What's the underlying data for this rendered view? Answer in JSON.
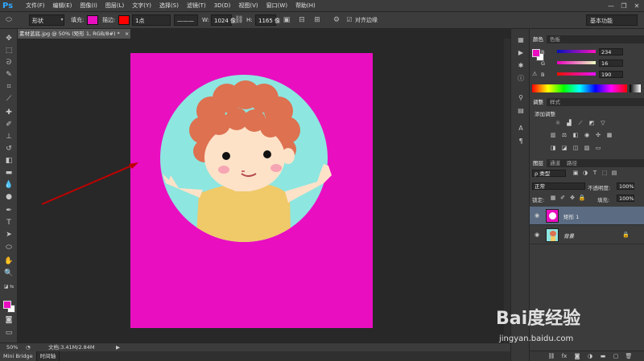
{
  "app": {
    "logo": "Ps"
  },
  "menu": [
    "文件(F)",
    "编辑(E)",
    "图像(I)",
    "图层(L)",
    "文字(Y)",
    "选择(S)",
    "滤镜(T)",
    "3D(D)",
    "视图(V)",
    "窗口(W)",
    "帮助(H)"
  ],
  "window_controls": {
    "minimize": "—",
    "restore": "❐",
    "close": "✕"
  },
  "options": {
    "shape_mode": "形状",
    "fill_label": "填充:",
    "fill_color": "#ea0ec1",
    "stroke_label": "描边:",
    "stroke_color": "#ff0000",
    "stroke_width": "1点",
    "w_label": "W:",
    "w_value": "1024 像",
    "h_label": "H:",
    "h_value": "1165 像",
    "align_edges_label": "对齐边缘",
    "align_edges_checked": true,
    "workspace": "基本功能"
  },
  "document": {
    "tab_title": "素材蓝底.jpg @ 50% (矩形 1, RGB/8#) *",
    "tab_close": "×",
    "background_color": "#ea0ec1",
    "circle_color": "#8de6e0",
    "hair_color": "#dd7150",
    "shirt_color": "#f0c969",
    "skin_color": "#fde2c8",
    "annotation_arrow_color": "#c00000"
  },
  "status": {
    "zoom": "50%",
    "doc_info": "文档:3.41M/2.84M"
  },
  "bottom_tabs": [
    "Mini Bridge",
    "时间轴"
  ],
  "color_panel": {
    "tabs": [
      "颜色",
      "色板"
    ],
    "fg_color": "#ea0ec1",
    "r_label": "R",
    "r_value": "234",
    "g_label": "G",
    "g_value": "16",
    "b_label": "B",
    "b_value": "190"
  },
  "adjust_panel": {
    "tabs": [
      "调整",
      "样式"
    ],
    "title": "添加调整"
  },
  "layers_panel": {
    "tabs": [
      "图层",
      "通道",
      "路径"
    ],
    "filter_kind": "ρ 类型",
    "blend_mode": "正常",
    "opacity_label": "不透明度:",
    "opacity_value": "100%",
    "lock_label": "锁定:",
    "fill_label": "填充:",
    "fill_value": "100%",
    "layers": [
      {
        "name": "矩形 1",
        "selected": true,
        "locked": false
      },
      {
        "name": "背景",
        "selected": false,
        "locked": true
      }
    ]
  },
  "watermark": {
    "brand": "Bai度经验",
    "url": "jingyan.baidu.com"
  }
}
